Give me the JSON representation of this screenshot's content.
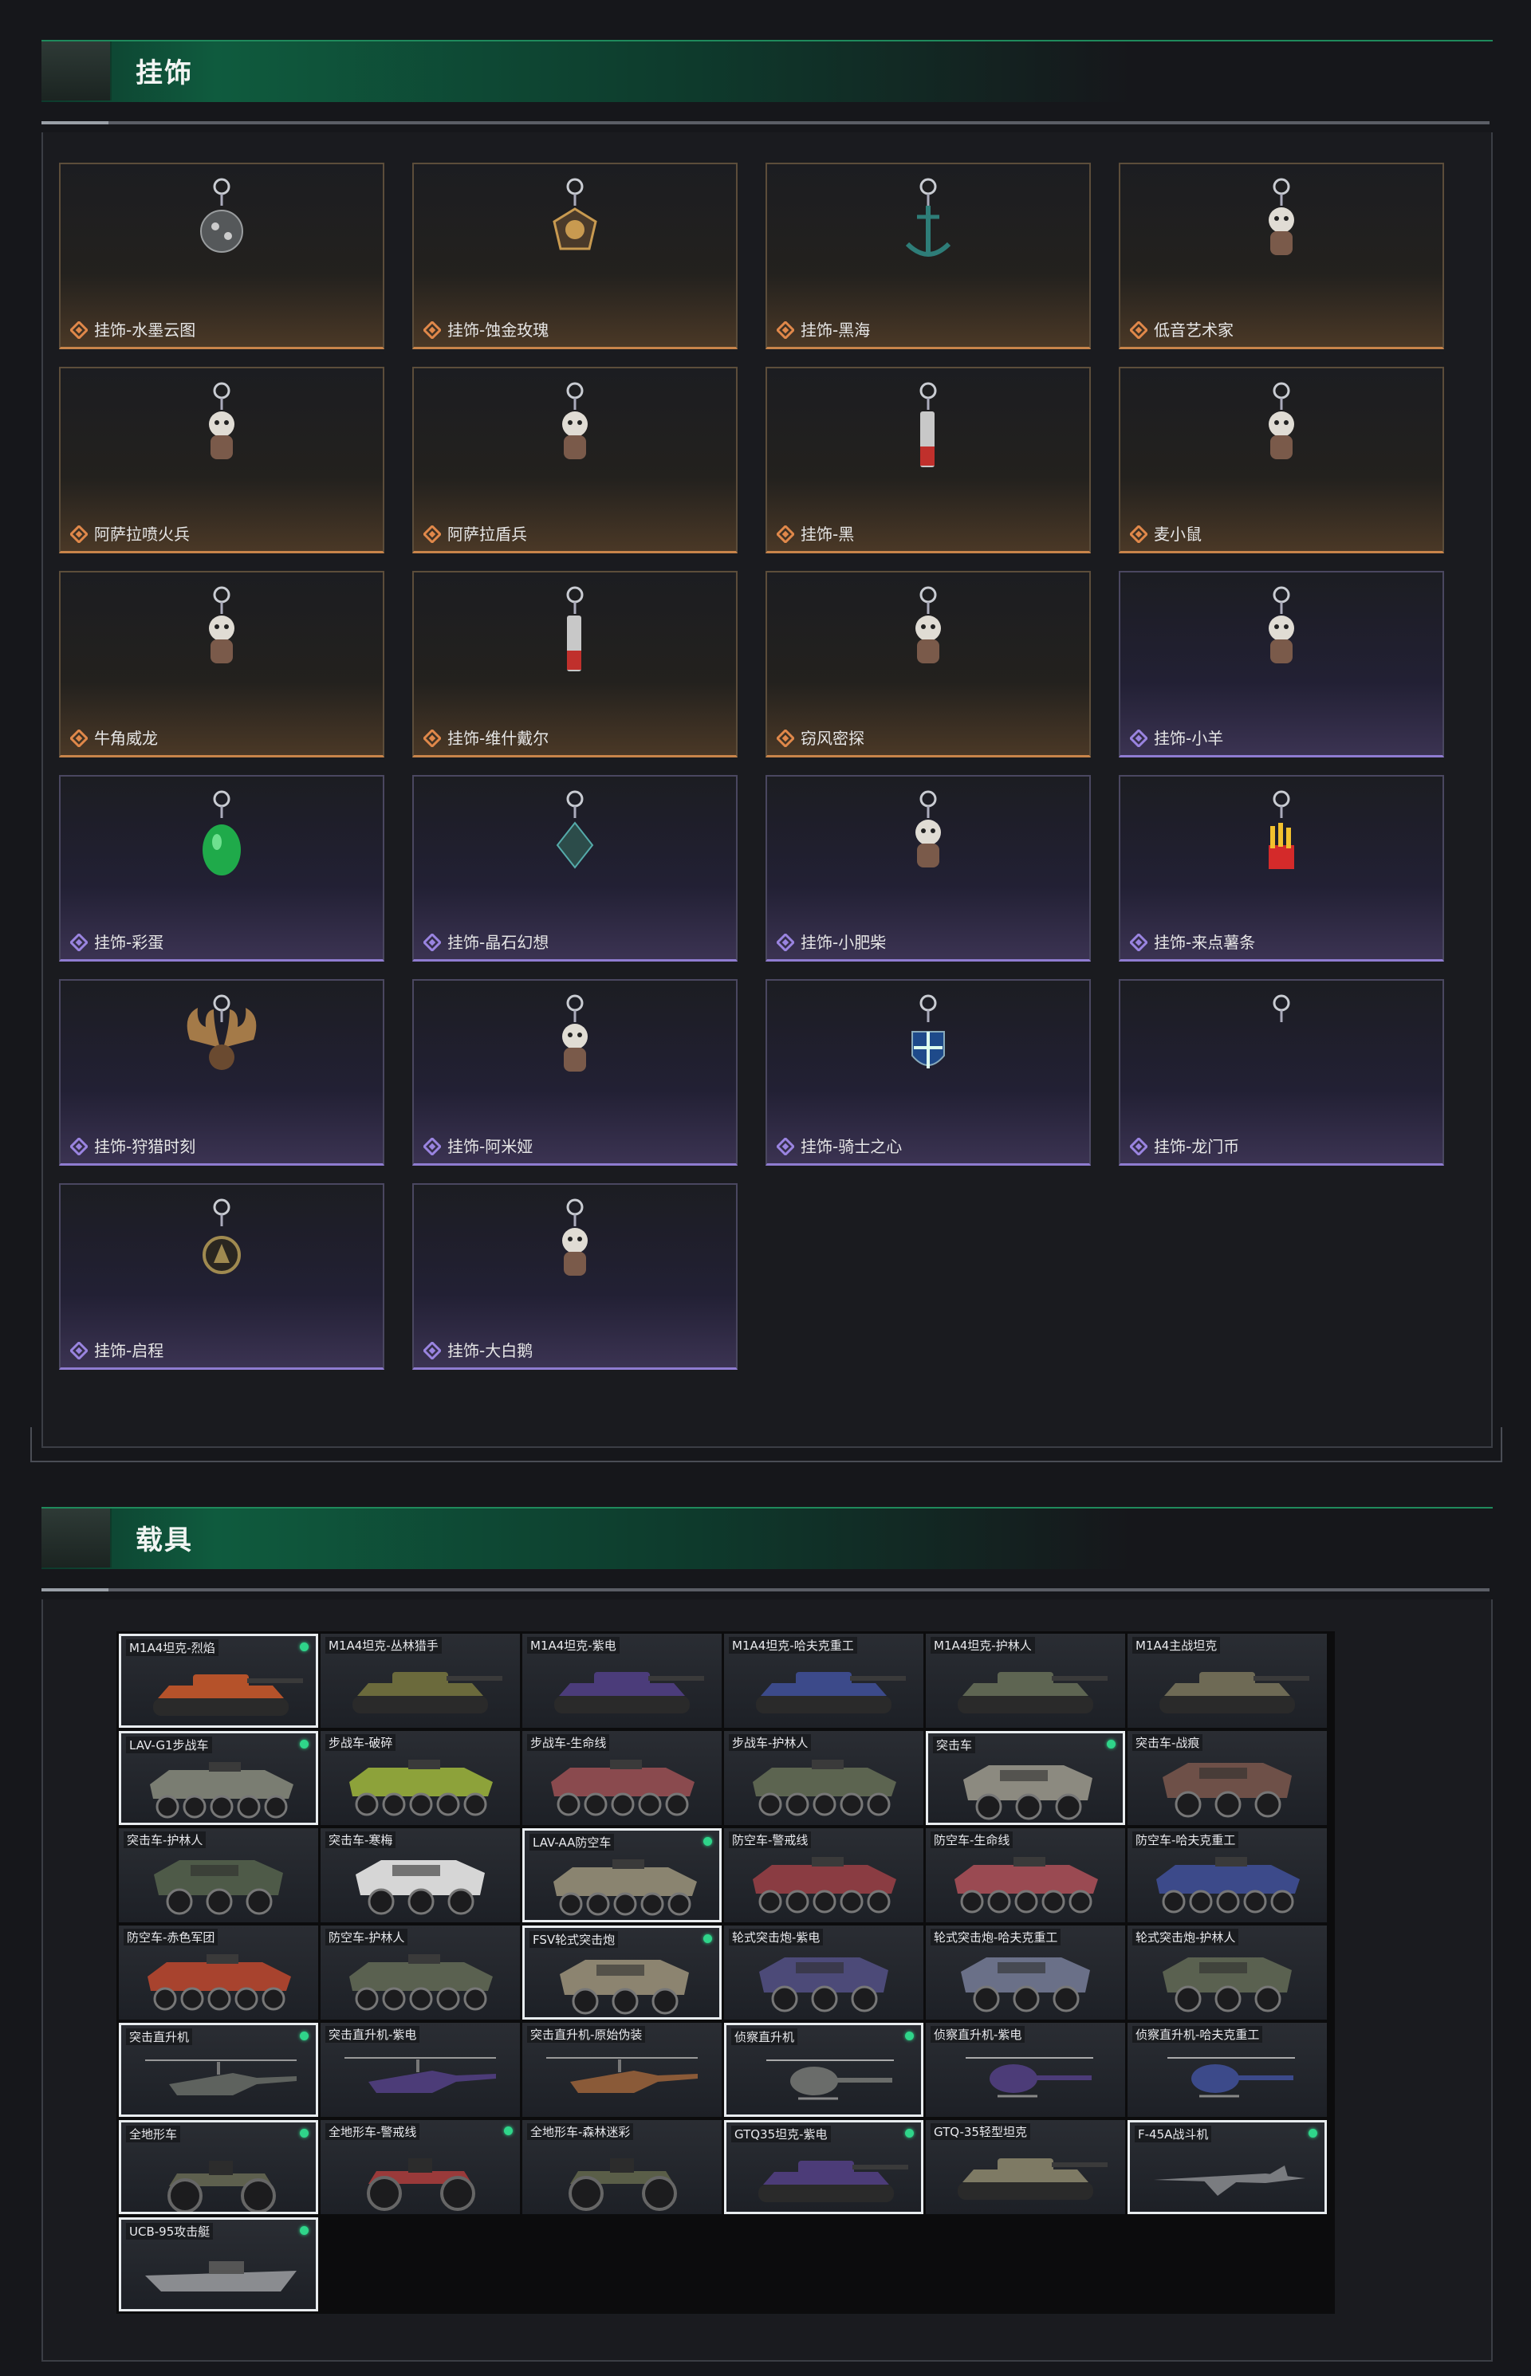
{
  "pendants_section": {
    "title": "挂饰",
    "items": [
      {
        "label": "挂饰-水墨云图",
        "rarity": "orange",
        "icon": "ornament-ball-icon"
      },
      {
        "label": "挂饰-蚀金玫瑰",
        "rarity": "orange",
        "icon": "rose-emblem-icon"
      },
      {
        "label": "挂饰-黑海",
        "rarity": "orange",
        "icon": "anchor-icon"
      },
      {
        "label": "低音艺术家",
        "rarity": "orange",
        "icon": "guitarist-figure-icon"
      },
      {
        "label": "阿萨拉喷火兵",
        "rarity": "orange",
        "icon": "flamethrower-soldier-icon"
      },
      {
        "label": "阿萨拉盾兵",
        "rarity": "orange",
        "icon": "shield-soldier-icon"
      },
      {
        "label": "挂饰-黑",
        "rarity": "orange",
        "icon": "blade-icon"
      },
      {
        "label": "麦小鼠",
        "rarity": "orange",
        "icon": "mouse-figure-icon"
      },
      {
        "label": "牛角威龙",
        "rarity": "orange",
        "icon": "horned-figure-icon"
      },
      {
        "label": "挂饰-维什戴尔",
        "rarity": "orange",
        "icon": "blade-icon"
      },
      {
        "label": "窃风密探",
        "rarity": "orange",
        "icon": "mouse-figure-icon"
      },
      {
        "label": "挂饰-小羊",
        "rarity": "purple",
        "icon": "sheep-figure-icon"
      },
      {
        "label": "挂饰-彩蛋",
        "rarity": "purple",
        "icon": "egg-icon"
      },
      {
        "label": "挂饰-晶石幻想",
        "rarity": "purple",
        "icon": "crystal-icon"
      },
      {
        "label": "挂饰-小肥柴",
        "rarity": "purple",
        "icon": "dog-figure-icon"
      },
      {
        "label": "挂饰-来点薯条",
        "rarity": "purple",
        "icon": "fries-icon"
      },
      {
        "label": "挂饰-狩猎时刻",
        "rarity": "purple",
        "icon": "antlers-icon"
      },
      {
        "label": "挂饰-阿米娅",
        "rarity": "purple",
        "icon": "bunny-figure-icon"
      },
      {
        "label": "挂饰-骑士之心",
        "rarity": "purple",
        "icon": "cross-shield-icon"
      },
      {
        "label": "挂饰-龙门币",
        "rarity": "purple",
        "icon": "coin-icon"
      },
      {
        "label": "挂饰-启程",
        "rarity": "purple",
        "icon": "medal-icon"
      },
      {
        "label": "挂饰-大白鹅",
        "rarity": "purple",
        "icon": "goose-figure-icon"
      }
    ]
  },
  "vehicles_section": {
    "title": "载具",
    "items": [
      {
        "label": "M1A4坦克-烈焰",
        "selected": true,
        "owned": true,
        "type": "tank",
        "color": "#b5522a"
      },
      {
        "label": "M1A4坦克-丛林猎手",
        "selected": false,
        "owned": false,
        "type": "tank",
        "color": "#6b6a3c"
      },
      {
        "label": "M1A4坦克-紫电",
        "selected": false,
        "owned": false,
        "type": "tank",
        "color": "#4b3c7a"
      },
      {
        "label": "M1A4坦克-哈夫克重工",
        "selected": false,
        "owned": false,
        "type": "tank",
        "color": "#3c4a8a"
      },
      {
        "label": "M1A4坦克-护林人",
        "selected": false,
        "owned": false,
        "type": "tank",
        "color": "#5e6552"
      },
      {
        "label": "M1A4主战坦克",
        "selected": false,
        "owned": false,
        "type": "tank",
        "color": "#6e6a55"
      },
      {
        "label": "LAV-G1步战车",
        "selected": true,
        "owned": true,
        "type": "apc",
        "color": "#7a7d72"
      },
      {
        "label": "步战车-破碎",
        "selected": false,
        "owned": false,
        "type": "apc",
        "color": "#8da23a"
      },
      {
        "label": "步战车-生命线",
        "selected": false,
        "owned": false,
        "type": "apc",
        "color": "#8a4a4e"
      },
      {
        "label": "步战车-护林人",
        "selected": false,
        "owned": false,
        "type": "apc",
        "color": "#5c6450"
      },
      {
        "label": "突击车",
        "selected": true,
        "owned": true,
        "type": "assault",
        "color": "#8c8a80"
      },
      {
        "label": "突击车-战痕",
        "selected": false,
        "owned": false,
        "type": "assault",
        "color": "#6e5048"
      },
      {
        "label": "突击车-护林人",
        "selected": false,
        "owned": false,
        "type": "assault",
        "color": "#4e5a48"
      },
      {
        "label": "突击车-寒梅",
        "selected": false,
        "owned": false,
        "type": "assault",
        "color": "#d6d6d6"
      },
      {
        "label": "LAV-AA防空车",
        "selected": true,
        "owned": true,
        "type": "apc",
        "color": "#8a8470"
      },
      {
        "label": "防空车-警戒线",
        "selected": false,
        "owned": false,
        "type": "apc",
        "color": "#8a3c42"
      },
      {
        "label": "防空车-生命线",
        "selected": false,
        "owned": false,
        "type": "apc",
        "color": "#9a4a52"
      },
      {
        "label": "防空车-哈夫克重工",
        "selected": false,
        "owned": false,
        "type": "apc",
        "color": "#3c4a8a"
      },
      {
        "label": "防空车-赤色军团",
        "selected": false,
        "owned": false,
        "type": "apc",
        "color": "#a8432e"
      },
      {
        "label": "防空车-护林人",
        "selected": false,
        "owned": false,
        "type": "apc",
        "color": "#5a6150"
      },
      {
        "label": "FSV轮式突击炮",
        "selected": true,
        "owned": true,
        "type": "assault",
        "color": "#8c8470"
      },
      {
        "label": "轮式突击炮-紫电",
        "selected": false,
        "owned": false,
        "type": "assault",
        "color": "#4c4a78"
      },
      {
        "label": "轮式突击炮-哈夫克重工",
        "selected": false,
        "owned": false,
        "type": "assault",
        "color": "#6a7088"
      },
      {
        "label": "轮式突击炮-护林人",
        "selected": false,
        "owned": false,
        "type": "assault",
        "color": "#5a6150"
      },
      {
        "label": "突击直升机",
        "selected": true,
        "owned": true,
        "type": "heli",
        "color": "#5e625e"
      },
      {
        "label": "突击直升机-紫电",
        "selected": false,
        "owned": false,
        "type": "heli",
        "color": "#4c3c78"
      },
      {
        "label": "突击直升机-原始伪装",
        "selected": false,
        "owned": false,
        "type": "heli",
        "color": "#8a5a38"
      },
      {
        "label": "侦察直升机",
        "selected": true,
        "owned": true,
        "type": "smallheli",
        "color": "#6a6c6a"
      },
      {
        "label": "侦察直升机-紫电",
        "selected": false,
        "owned": false,
        "type": "smallheli",
        "color": "#4c3c78"
      },
      {
        "label": "侦察直升机-哈夫克重工",
        "selected": false,
        "owned": false,
        "type": "smallheli",
        "color": "#3c4a8a"
      },
      {
        "label": "全地形车",
        "selected": true,
        "owned": true,
        "type": "atv",
        "color": "#5e604e"
      },
      {
        "label": "全地形车-警戒线",
        "selected": false,
        "owned": true,
        "type": "atv",
        "color": "#9a3a3a"
      },
      {
        "label": "全地形车-森林迷彩",
        "selected": false,
        "owned": false,
        "type": "atv",
        "color": "#5a5e48"
      },
      {
        "label": "GTQ35坦克-紫电",
        "selected": true,
        "owned": true,
        "type": "tank",
        "color": "#4c3c78"
      },
      {
        "label": "GTQ-35轻型坦克",
        "selected": false,
        "owned": false,
        "type": "tank",
        "color": "#7e7a64"
      },
      {
        "label": "F-45A战斗机",
        "selected": true,
        "owned": true,
        "type": "jet",
        "color": "#7a7c80"
      },
      {
        "label": "UCB-95攻击艇",
        "selected": true,
        "owned": true,
        "type": "boat",
        "color": "#8a8c90"
      }
    ]
  }
}
